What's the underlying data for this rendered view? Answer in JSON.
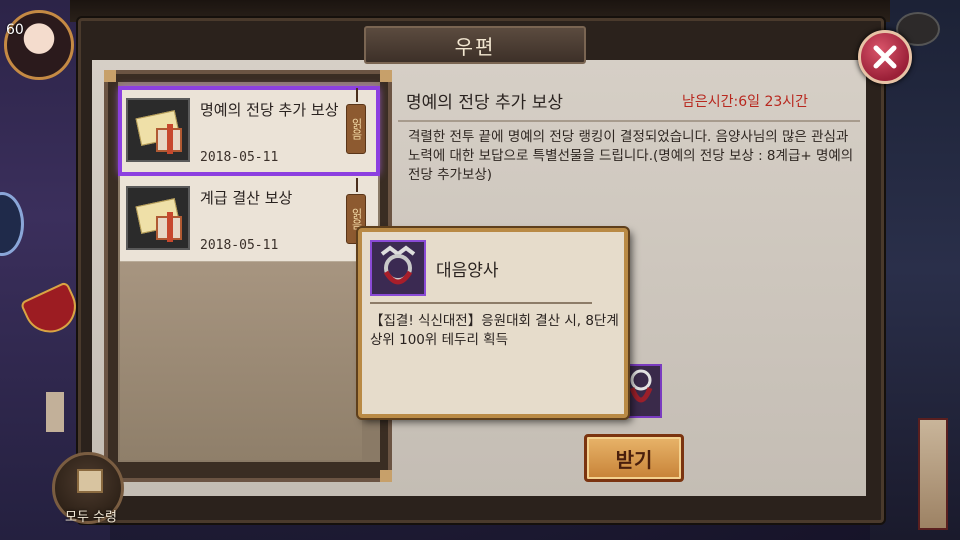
{
  "hud": {
    "level": "60"
  },
  "window": {
    "title": "우편",
    "close_icon": "close-x-icon"
  },
  "mail_list": [
    {
      "title": "명예의 전당 추가 보상",
      "date": "2018-05-11",
      "tag": "읽음",
      "selected": true
    },
    {
      "title": "계급 결산 보상",
      "date": "2018-05-11",
      "tag": "읽음",
      "selected": false
    }
  ],
  "detail": {
    "title": "명예의 전당 추가 보상",
    "time_left": "남은시간:6일 23시간",
    "body": "격렬한 전투 끝에 명예의 전당 랭킹이 결정되었습니다. 음양사님의 많은 관심과 노력에 대한 보답으로 특별선물을 드립니다.(명예의 전당 보상 : 8계급+ 명예의전당 추가보상)",
    "receive_label": "받기"
  },
  "tooltip": {
    "name": "대음양사",
    "description": "【집결! 식신대전】응원대회 결산 시, 8단계 상위 100위 테두리 획득"
  },
  "footer": {
    "claim_all_label": "모두 수령"
  },
  "colors": {
    "selected_outline": "#8c3fe0",
    "time_left_red": "#b8281f",
    "button_gold": "#d99a4e"
  }
}
